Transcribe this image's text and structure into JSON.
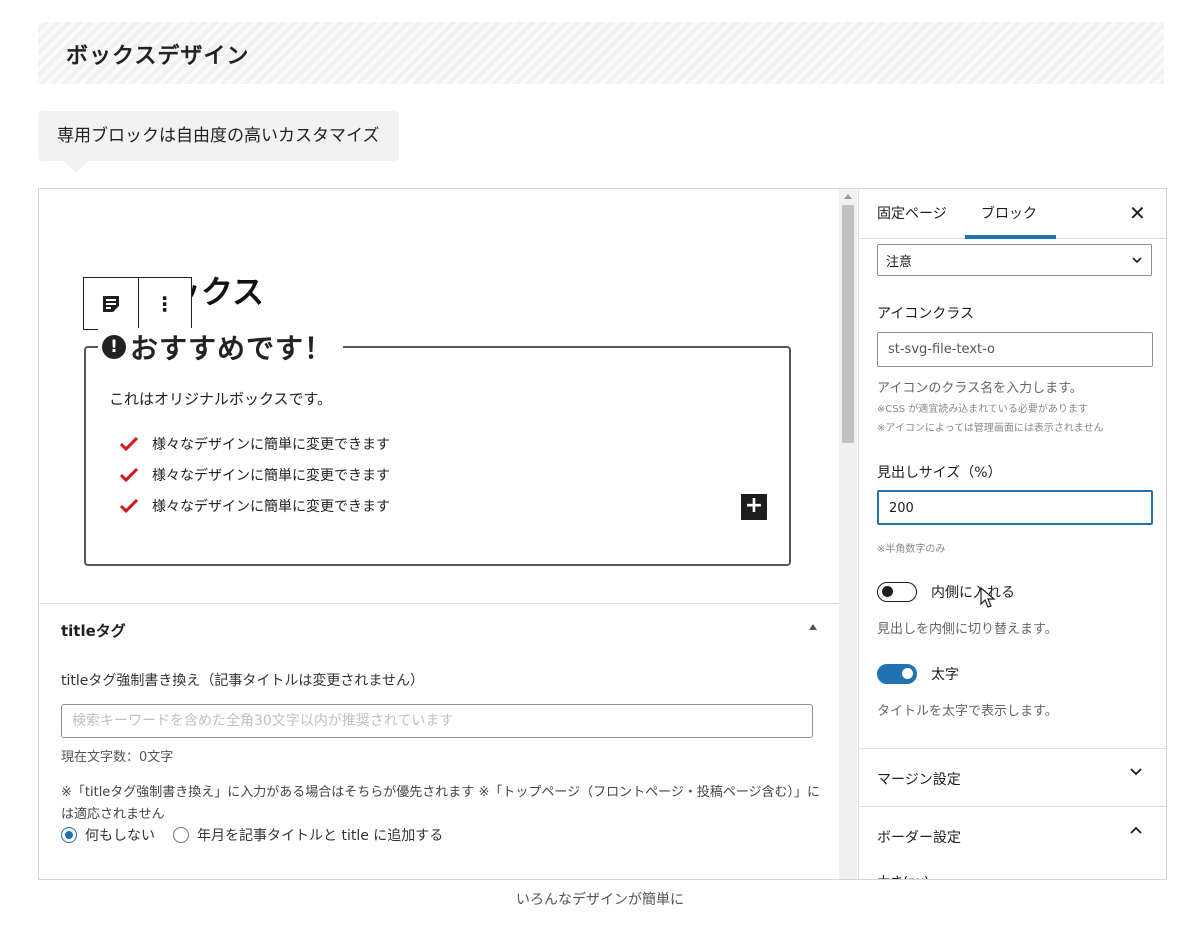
{
  "section_heading": "ボックスデザイン",
  "bubble_text": "専用ブロックは自由度の高いカスタマイズ",
  "caption": "いろんなデザインが簡単に",
  "editor": {
    "block_title": "ックス",
    "box": {
      "legend": "おすすめです！",
      "body": "これはオリジナルボックスです。",
      "list": [
        "様々なデザインに簡単に変更できます",
        "様々なデザインに簡単に変更できます",
        "様々なデザインに簡単に変更できます"
      ],
      "add_symbol": "+"
    },
    "meta": {
      "title": "titleタグ",
      "field_label": "titleタグ強制書き換え（記事タイトルは変更されません）",
      "placeholder": "検索キーワードを含めた全角30文字以内が推奨されています",
      "count": "現在文字数：0文字",
      "note": "※「titleタグ強制書き換え」に入力がある場合はそちらが優先されます ※「トップページ（フロントページ・投稿ページ含む）」には適応されません",
      "radio_1": "何もしない",
      "radio_2": "年月を記事タイトルと title に追加する"
    }
  },
  "sidebar": {
    "tab_page": "固定ページ",
    "tab_block": "ブロック",
    "close": "✕",
    "select_value": "注意",
    "icon_class_label": "アイコンクラス",
    "icon_class_value": "st-svg-file-text-o",
    "icon_class_help": "アイコンのクラス名を入力します。",
    "icon_note_1": "※CSS が適宜読み込まれている必要があります",
    "icon_note_2": "※アイコンによっては管理画面には表示されません",
    "heading_size_label": "見出しサイズ（%）",
    "heading_size_value": "200",
    "heading_size_note": "※半角数字のみ",
    "inner_toggle_label": "内側に入れる",
    "inner_toggle_help": "見出しを内側に切り替えます。",
    "bold_toggle_label": "太字",
    "bold_toggle_help": "タイトルを太字で表示します。",
    "margin_section": "マージン設定",
    "border_section": "ボーダー設定",
    "cut_label": "太さ(px)"
  },
  "colors": {
    "accent": "#2271b1",
    "check": "#d0171a"
  }
}
